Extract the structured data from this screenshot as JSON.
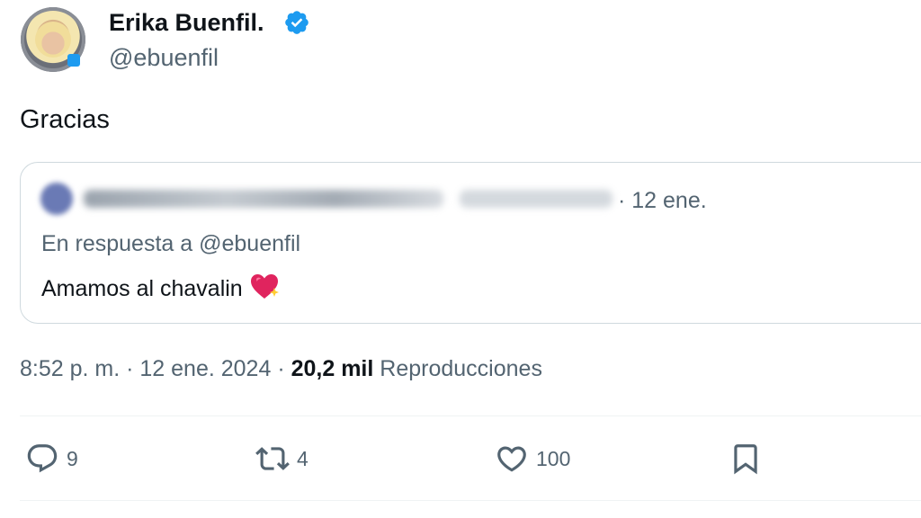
{
  "author": {
    "display_name": "Erika Buenfil.",
    "handle": "@ebuenfil"
  },
  "tweet": {
    "text": "Gracias"
  },
  "quote": {
    "date": "· 12 ene.",
    "reply_to": "En respuesta a @ebuenfil",
    "text": "Amamos al chavalin",
    "emoji_icon": "sparkling-heart-icon"
  },
  "meta": {
    "time": "8:52 p. m.",
    "sep1": " · ",
    "date": "12 ene. 2024",
    "sep2": " · ",
    "views_count": "20,2 mil",
    "views_label": "Reproducciones"
  },
  "actions": {
    "replies": "9",
    "retweets": "4",
    "likes": "100"
  },
  "colors": {
    "verified": "#1d9bf0",
    "secondary_text": "#536471",
    "primary_text": "#0f1419"
  }
}
